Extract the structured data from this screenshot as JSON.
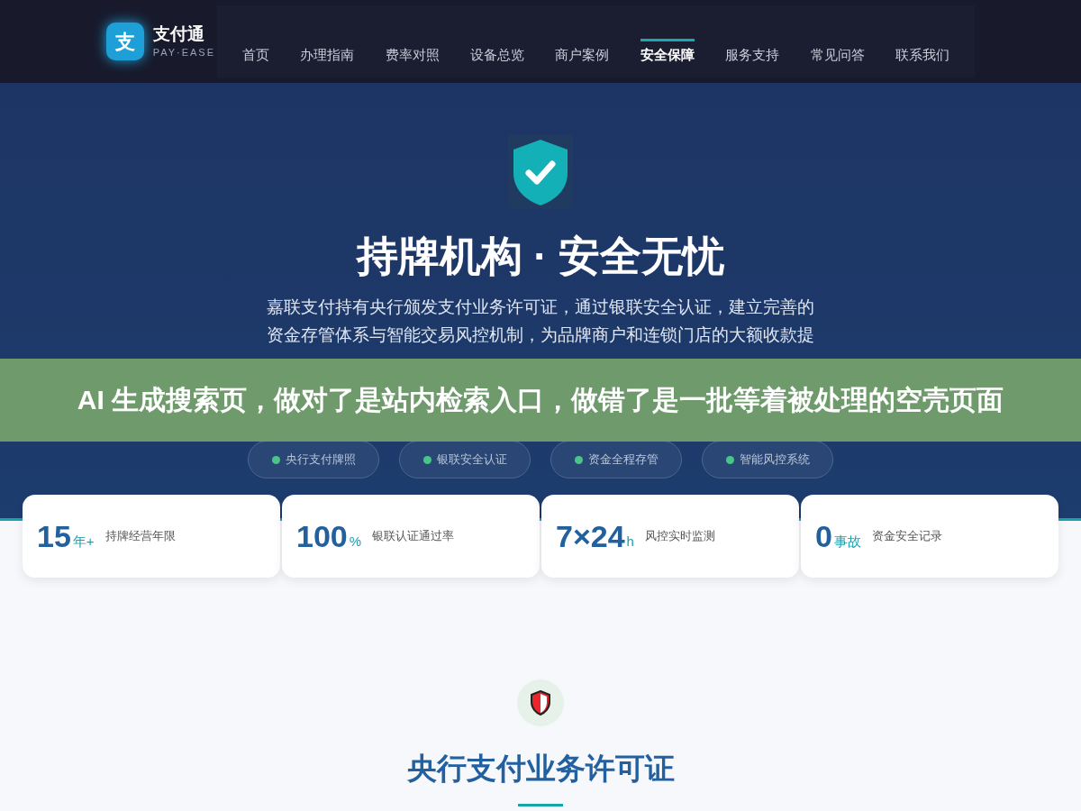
{
  "brand": {
    "logo_letter": "支",
    "name": "支付通",
    "tagline": "PAY·EASE"
  },
  "nav": [
    {
      "label": "首页",
      "selected": false
    },
    {
      "label": "办理指南",
      "selected": false
    },
    {
      "label": "费率对照",
      "selected": false
    },
    {
      "label": "设备总览",
      "selected": false
    },
    {
      "label": "商户案例",
      "selected": false
    },
    {
      "label": "安全保障",
      "selected": true
    },
    {
      "label": "服务支持",
      "selected": false
    },
    {
      "label": "常见问答",
      "selected": false
    },
    {
      "label": "联系我们",
      "selected": false
    }
  ],
  "hero": {
    "title": "持牌机构 · 安全无忧",
    "paragraph_lines": [
      "嘉联支付持有央行颁发支付业务许可证，通过银联安全认证，建立完善的",
      "资金存管体系与智能交易风控机制，为品牌商户和连锁门店的大额收款提"
    ],
    "pills": [
      "央行支付牌照",
      "银联安全认证",
      "资金全程存管",
      "智能风控系统"
    ]
  },
  "overlay_banner": {
    "text": "AI 生成搜索页，做对了是站内检索入口，做错了是一批等着被处理的空壳页面"
  },
  "stats": [
    {
      "number": "15",
      "unit": "年+",
      "label": "持牌经营年限"
    },
    {
      "number": "100",
      "unit": "%",
      "label": "银联认证通过率"
    },
    {
      "number": "7×24",
      "unit": "h",
      "label": "风控实时监测"
    },
    {
      "number": "0",
      "unit": "事故",
      "label": "资金安全记录"
    }
  ],
  "section": {
    "title": "央行支付业务许可证"
  }
}
